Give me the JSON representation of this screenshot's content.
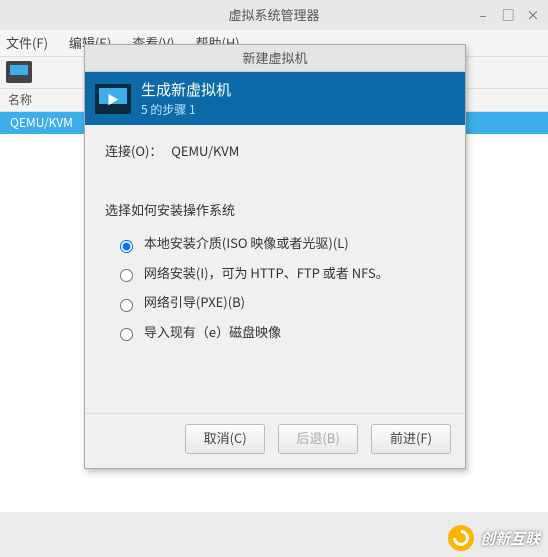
{
  "window": {
    "title": "虚拟系统管理器",
    "controls": {
      "min": "–",
      "max": "□",
      "close": "×"
    }
  },
  "menubar": {
    "file": "文件(F)",
    "edit": "编辑(E)",
    "view": "查看(V)",
    "help": "帮助(H)"
  },
  "list": {
    "header": "名称",
    "row0": "QEMU/KVM"
  },
  "modal": {
    "title": "新建虚拟机",
    "header": {
      "h1": "生成新虚拟机",
      "h2": "5 的步骤 1"
    },
    "conn_label": "连接(O)：",
    "conn_value": "QEMU/KVM",
    "install_label": "选择如何安装操作系统",
    "options": {
      "local": "本地安装介质(ISO 映像或者光驱)(L)",
      "net": "网络安装(I)，可为 HTTP、FTP 或者 NFS。",
      "pxe": "网络引导(PXE)(B)",
      "import": "导入现有（e）磁盘映像"
    },
    "buttons": {
      "cancel": "取消(C)",
      "back": "后退(B)",
      "forward": "前进(F)"
    }
  },
  "brand": "创新互联"
}
